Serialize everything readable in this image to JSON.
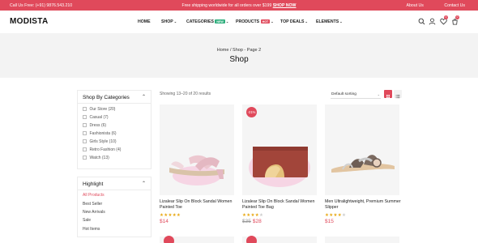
{
  "topbar": {
    "call": "Call Us Free: (+91) 9876.543.210",
    "shipping": "Free shipping worldwide for all orders over $199",
    "shop_now": "SHOP NOW",
    "about": "About Us",
    "contact": "Contact Us"
  },
  "header": {
    "logo": "MODISTA",
    "nav": [
      {
        "label": "HOME"
      },
      {
        "label": "SHOP"
      },
      {
        "label": "CATEGORIES",
        "badge": "NEW"
      },
      {
        "label": "PRODUCTS",
        "badge": "HOT"
      },
      {
        "label": "TOP DEALS"
      },
      {
        "label": "ELEMENTS"
      }
    ],
    "wishlist_count": "0",
    "cart_count": "0"
  },
  "page": {
    "breadcrumb": "Home / Shop - Page 2",
    "title": "Shop"
  },
  "sidebar": {
    "categories_title": "Shop By Categories",
    "categories": [
      "Our Store (20)",
      "Casual (7)",
      "Dress (6)",
      "Fashionista (6)",
      "Girls Style (10)",
      "Retro Fashion (4)",
      "Watch (13)"
    ],
    "highlight_title": "Highlight",
    "highlights": [
      "All Products",
      "Best Seller",
      "New Arrivals",
      "Sale",
      "Hot Items"
    ]
  },
  "toolbar": {
    "showing": "Showing 13–20 of 20 results",
    "sort": "Default sorting"
  },
  "products": [
    {
      "name": "Lizalear Slip On Block Sandal Women Painted Toe",
      "price": "$14",
      "old_price": "",
      "rating": 5,
      "discount": ""
    },
    {
      "name": "Lizalear Slip On Block Sandal Women Painted Toe Bag",
      "price": "$28",
      "old_price": "$35",
      "rating": 4,
      "discount": "-21%"
    },
    {
      "name": "Men Ultralightweight, Premium Summer Slipper",
      "price": "$15",
      "old_price": "",
      "rating": 4,
      "discount": ""
    }
  ],
  "colors": {
    "accent": "#e0495b",
    "new_badge": "#2fae7d",
    "star": "#e8a915"
  }
}
